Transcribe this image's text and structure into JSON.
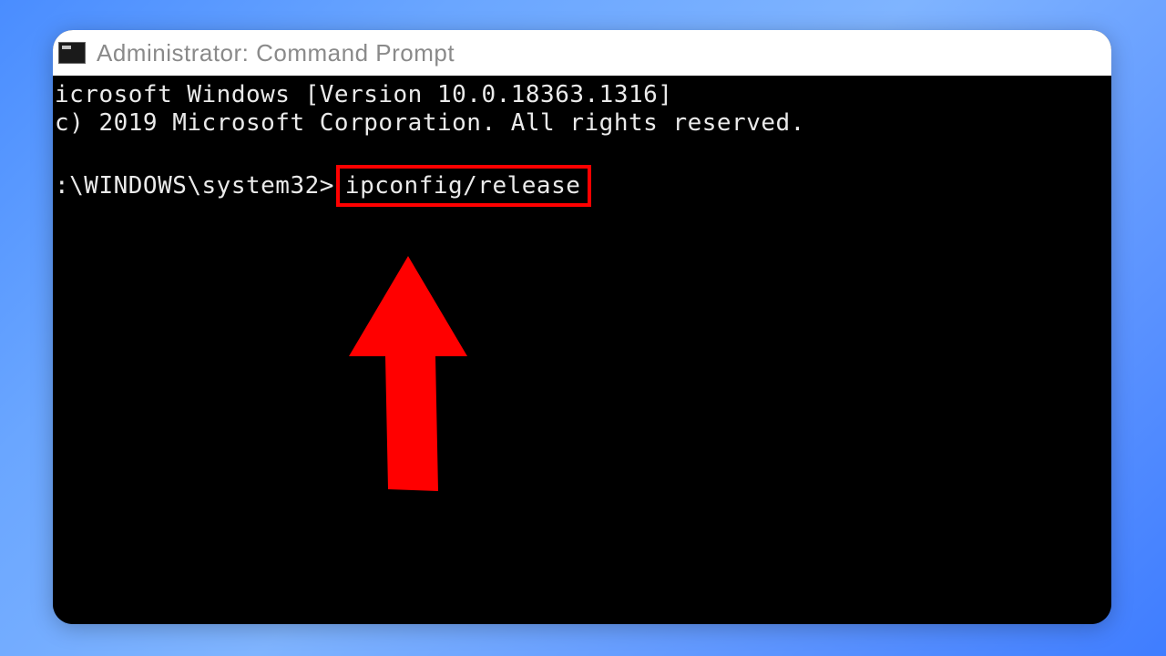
{
  "window": {
    "title": "Administrator: Command Prompt"
  },
  "terminal": {
    "line1": "icrosoft Windows [Version 10.0.18363.1316]",
    "line2": "c) 2019 Microsoft Corporation. All rights reserved.",
    "prompt_prefix": ":\\WINDOWS\\system32>",
    "command": "ipconfig/release"
  },
  "annotation": {
    "highlight_color": "#ff0000",
    "arrow_color": "#ff0000"
  }
}
